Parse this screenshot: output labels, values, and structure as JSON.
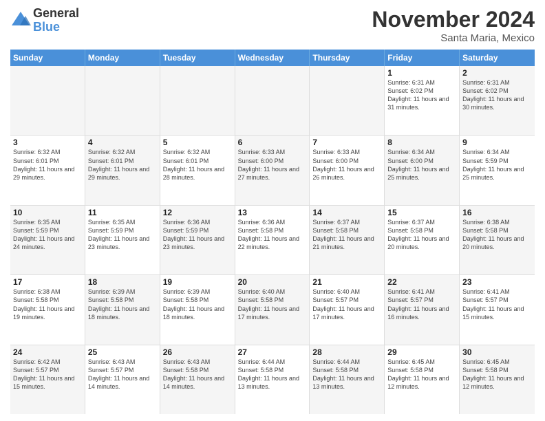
{
  "header": {
    "logo_general": "General",
    "logo_blue": "Blue",
    "month_title": "November 2024",
    "location": "Santa Maria, Mexico"
  },
  "weekdays": [
    "Sunday",
    "Monday",
    "Tuesday",
    "Wednesday",
    "Thursday",
    "Friday",
    "Saturday"
  ],
  "rows": [
    [
      {
        "day": "",
        "info": "",
        "shaded": true
      },
      {
        "day": "",
        "info": "",
        "shaded": true
      },
      {
        "day": "",
        "info": "",
        "shaded": true
      },
      {
        "day": "",
        "info": "",
        "shaded": true
      },
      {
        "day": "",
        "info": "",
        "shaded": true
      },
      {
        "day": "1",
        "info": "Sunrise: 6:31 AM\nSunset: 6:02 PM\nDaylight: 11 hours and 31 minutes.",
        "shaded": false
      },
      {
        "day": "2",
        "info": "Sunrise: 6:31 AM\nSunset: 6:02 PM\nDaylight: 11 hours and 30 minutes.",
        "shaded": true
      }
    ],
    [
      {
        "day": "3",
        "info": "Sunrise: 6:32 AM\nSunset: 6:01 PM\nDaylight: 11 hours and 29 minutes.",
        "shaded": false
      },
      {
        "day": "4",
        "info": "Sunrise: 6:32 AM\nSunset: 6:01 PM\nDaylight: 11 hours and 29 minutes.",
        "shaded": true
      },
      {
        "day": "5",
        "info": "Sunrise: 6:32 AM\nSunset: 6:01 PM\nDaylight: 11 hours and 28 minutes.",
        "shaded": false
      },
      {
        "day": "6",
        "info": "Sunrise: 6:33 AM\nSunset: 6:00 PM\nDaylight: 11 hours and 27 minutes.",
        "shaded": true
      },
      {
        "day": "7",
        "info": "Sunrise: 6:33 AM\nSunset: 6:00 PM\nDaylight: 11 hours and 26 minutes.",
        "shaded": false
      },
      {
        "day": "8",
        "info": "Sunrise: 6:34 AM\nSunset: 6:00 PM\nDaylight: 11 hours and 25 minutes.",
        "shaded": true
      },
      {
        "day": "9",
        "info": "Sunrise: 6:34 AM\nSunset: 5:59 PM\nDaylight: 11 hours and 25 minutes.",
        "shaded": false
      }
    ],
    [
      {
        "day": "10",
        "info": "Sunrise: 6:35 AM\nSunset: 5:59 PM\nDaylight: 11 hours and 24 minutes.",
        "shaded": true
      },
      {
        "day": "11",
        "info": "Sunrise: 6:35 AM\nSunset: 5:59 PM\nDaylight: 11 hours and 23 minutes.",
        "shaded": false
      },
      {
        "day": "12",
        "info": "Sunrise: 6:36 AM\nSunset: 5:59 PM\nDaylight: 11 hours and 23 minutes.",
        "shaded": true
      },
      {
        "day": "13",
        "info": "Sunrise: 6:36 AM\nSunset: 5:58 PM\nDaylight: 11 hours and 22 minutes.",
        "shaded": false
      },
      {
        "day": "14",
        "info": "Sunrise: 6:37 AM\nSunset: 5:58 PM\nDaylight: 11 hours and 21 minutes.",
        "shaded": true
      },
      {
        "day": "15",
        "info": "Sunrise: 6:37 AM\nSunset: 5:58 PM\nDaylight: 11 hours and 20 minutes.",
        "shaded": false
      },
      {
        "day": "16",
        "info": "Sunrise: 6:38 AM\nSunset: 5:58 PM\nDaylight: 11 hours and 20 minutes.",
        "shaded": true
      }
    ],
    [
      {
        "day": "17",
        "info": "Sunrise: 6:38 AM\nSunset: 5:58 PM\nDaylight: 11 hours and 19 minutes.",
        "shaded": false
      },
      {
        "day": "18",
        "info": "Sunrise: 6:39 AM\nSunset: 5:58 PM\nDaylight: 11 hours and 18 minutes.",
        "shaded": true
      },
      {
        "day": "19",
        "info": "Sunrise: 6:39 AM\nSunset: 5:58 PM\nDaylight: 11 hours and 18 minutes.",
        "shaded": false
      },
      {
        "day": "20",
        "info": "Sunrise: 6:40 AM\nSunset: 5:58 PM\nDaylight: 11 hours and 17 minutes.",
        "shaded": true
      },
      {
        "day": "21",
        "info": "Sunrise: 6:40 AM\nSunset: 5:57 PM\nDaylight: 11 hours and 17 minutes.",
        "shaded": false
      },
      {
        "day": "22",
        "info": "Sunrise: 6:41 AM\nSunset: 5:57 PM\nDaylight: 11 hours and 16 minutes.",
        "shaded": true
      },
      {
        "day": "23",
        "info": "Sunrise: 6:41 AM\nSunset: 5:57 PM\nDaylight: 11 hours and 15 minutes.",
        "shaded": false
      }
    ],
    [
      {
        "day": "24",
        "info": "Sunrise: 6:42 AM\nSunset: 5:57 PM\nDaylight: 11 hours and 15 minutes.",
        "shaded": true
      },
      {
        "day": "25",
        "info": "Sunrise: 6:43 AM\nSunset: 5:57 PM\nDaylight: 11 hours and 14 minutes.",
        "shaded": false
      },
      {
        "day": "26",
        "info": "Sunrise: 6:43 AM\nSunset: 5:58 PM\nDaylight: 11 hours and 14 minutes.",
        "shaded": true
      },
      {
        "day": "27",
        "info": "Sunrise: 6:44 AM\nSunset: 5:58 PM\nDaylight: 11 hours and 13 minutes.",
        "shaded": false
      },
      {
        "day": "28",
        "info": "Sunrise: 6:44 AM\nSunset: 5:58 PM\nDaylight: 11 hours and 13 minutes.",
        "shaded": true
      },
      {
        "day": "29",
        "info": "Sunrise: 6:45 AM\nSunset: 5:58 PM\nDaylight: 11 hours and 12 minutes.",
        "shaded": false
      },
      {
        "day": "30",
        "info": "Sunrise: 6:45 AM\nSunset: 5:58 PM\nDaylight: 11 hours and 12 minutes.",
        "shaded": true
      }
    ]
  ]
}
